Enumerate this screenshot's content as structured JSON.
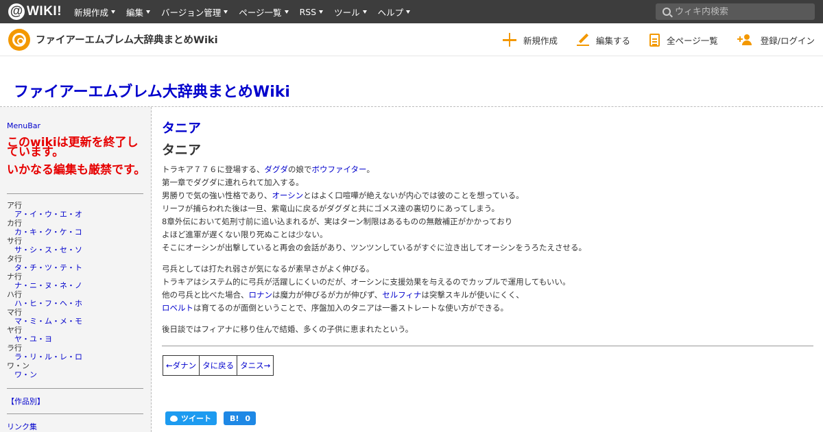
{
  "topbar": {
    "logo_text": "WIKI!",
    "logo_at": "@",
    "menu": [
      "新規作成",
      "編集",
      "バージョン管理",
      "ページ一覧",
      "RSS",
      "ツール",
      "ヘルプ"
    ],
    "search_placeholder": "ウィキ内検索"
  },
  "header": {
    "site_name": "ファイアーエムブレム大辞典まとめWiki",
    "actions": {
      "create": "新規作成",
      "edit": "編集する",
      "all_pages": "全ページ一覧",
      "login": "登録/ログイン"
    }
  },
  "page_title": "ファイアーエムブレム大辞典まとめWiki",
  "sidebar": {
    "menubar": "MenuBar",
    "warning1": "このwikiは更新を終了しています。",
    "warning2": "いかなる編集も厳禁です。",
    "nav": [
      {
        "head": "ア行",
        "link": "ア・イ・ウ・エ・オ"
      },
      {
        "head": "カ行",
        "link": "カ・キ・ク・ケ・コ"
      },
      {
        "head": "サ行",
        "link": "サ・シ・ス・セ・ソ"
      },
      {
        "head": "タ行",
        "link": "タ・チ・ツ・テ・ト"
      },
      {
        "head": "ナ行",
        "link": "ナ・ニ・ヌ・ネ・ノ"
      },
      {
        "head": "ハ行",
        "link": "ハ・ヒ・フ・ヘ・ホ"
      },
      {
        "head": "マ行",
        "link": "マ・ミ・ム・メ・モ"
      },
      {
        "head": "ヤ行",
        "link": "ヤ・ユ・ヨ"
      },
      {
        "head": "ラ行",
        "link": "ラ・リ・ル・レ・ロ"
      },
      {
        "head": "ワ・ン",
        "link": "ワ・ン"
      }
    ],
    "by_work": "【作品別】",
    "links": "リンク集"
  },
  "main": {
    "title_link": "タニア",
    "title": "タニア",
    "para1": {
      "line1_a": "トラキア７７６に登場する、",
      "line1_link1": "ダグダ",
      "line1_b": "の娘で",
      "line1_link2": "ボウファイター",
      "line1_c": "。",
      "line2": "第一章でダグダに連れられて加入する。",
      "line3_a": "男勝りで気の強い性格であり、",
      "line3_link": "オーシン",
      "line3_b": "とはよく口喧嘩が絶えないが内心では彼のことを想っている。",
      "line4": "リーフが捕らわれた後は一旦、紫竜山に戻るがダグダと共にゴメス達の裏切りにあってしまう。",
      "line5": "8章外伝において処刑寸前に追い込まれるが、実はターン制限はあるものの無敵補正がかかっており",
      "line6": "よほど進軍が遅くない限り死ぬことは少ない。",
      "line7": "そこにオーシンが出撃していると再会の会話があり、ツンツンしているがすぐに泣き出してオーシンをうろたえさせる。"
    },
    "para2": {
      "line1": "弓兵としては打たれ弱さが気になるが素早さがよく伸びる。",
      "line2": "トラキアはシステム的に弓兵が活躍しにくいのだが、オーシンに支援効果を与えるのでカップルで運用してもいい。",
      "line3_a": "他の弓兵と比べた場合、",
      "line3_link1": "ロナン",
      "line3_b": "は魔力が伸びるが力が伸びず、",
      "line3_link2": "セルフィナ",
      "line3_c": "は突撃スキルが使いにくく、",
      "line4_link": "ロベルト",
      "line4_b": "は育てるのが面倒ということで、序盤加入のタニアは一番ストレートな使い方ができる。"
    },
    "para3": "後日談ではフィアナに移り住んで結婚、多くの子供に恵まれたという。",
    "nav": {
      "prev": "←ダナン",
      "up": "タに戻る",
      "next": "タニス→"
    },
    "share": {
      "tweet": "ツイート",
      "hatena": "B!",
      "hatena_count": "0"
    }
  }
}
